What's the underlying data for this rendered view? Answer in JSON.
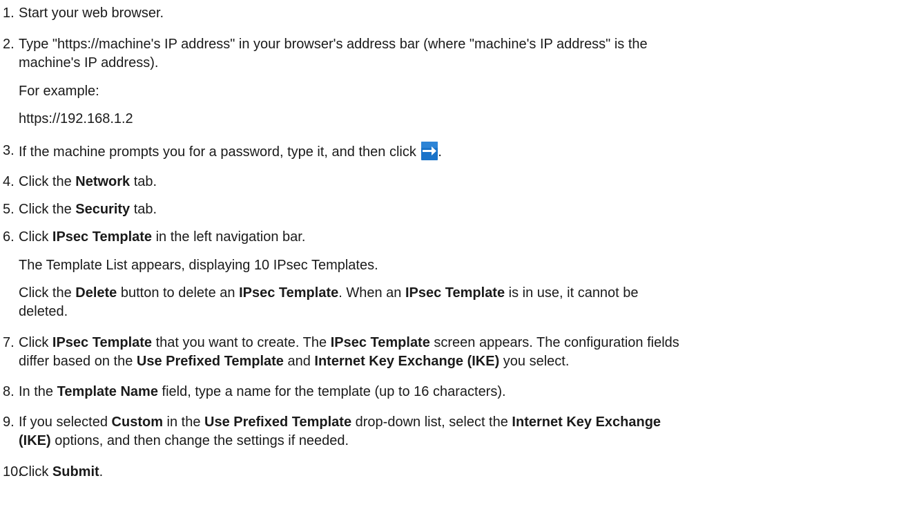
{
  "steps": [
    {
      "num": "1.",
      "lines": [
        [
          "Start your web browser."
        ]
      ]
    },
    {
      "num": "2.",
      "lines": [
        [
          "Type \"https://machine's IP address\" in your browser's address bar (where \"machine's IP address\" is the"
        ],
        [
          "machine's IP address)."
        ]
      ]
    },
    {
      "extra": [
        "For example:",
        "https://192.168.1.2"
      ]
    },
    {
      "num": "3.",
      "lines": [
        [
          "If the machine prompts you for a password, type it, and then click ",
          "."
        ]
      ]
    },
    {
      "num": "4.",
      "lines": [
        [
          "Click the ",
          "Network",
          " tab."
        ]
      ]
    },
    {
      "num": "5.",
      "lines": [
        [
          "Click the ",
          "Security",
          " tab."
        ]
      ]
    },
    {
      "num": "6.",
      "lines": [
        [
          "Click ",
          "IPsec Template",
          " in the left navigation bar."
        ]
      ]
    },
    {
      "extra": [
        "The Template List appears, displaying 10 IPsec Templates."
      ]
    },
    {
      "extra_rich": [
        [
          "Click the ",
          "Delete",
          " button to delete an ",
          "IPsec Template",
          ". When an ",
          "IPsec Template",
          " is in use, it cannot be"
        ],
        [
          "deleted."
        ]
      ]
    },
    {
      "num": "7.",
      "lines": [
        [
          "Click ",
          "IPsec Template",
          " that you want to create. The ",
          "IPsec Template",
          " screen appears. The configuration fields"
        ],
        [
          "differ based on the ",
          "Use Prefixed Template",
          " and ",
          "Internet Key Exchange (IKE)",
          " you select."
        ]
      ]
    },
    {
      "num": "8.",
      "lines": [
        [
          "In the ",
          "Template Name",
          " field, type a name for the template (up to 16 characters)."
        ]
      ]
    },
    {
      "num": "9.",
      "lines": [
        [
          "If you selected ",
          "Custom",
          " in the ",
          "Use Prefixed Template",
          " drop-down list, select the ",
          "Internet Key Exchange"
        ],
        [
          "(IKE)",
          " options, and then change the settings if needed."
        ]
      ]
    },
    {
      "num": "10.",
      "lines": [
        [
          "Click ",
          "Submit",
          "."
        ]
      ]
    }
  ],
  "icons": {
    "go_arrow": "right-arrow-icon",
    "arrow_bg": "#1a73c9",
    "arrow_fg": "#ffffff"
  }
}
